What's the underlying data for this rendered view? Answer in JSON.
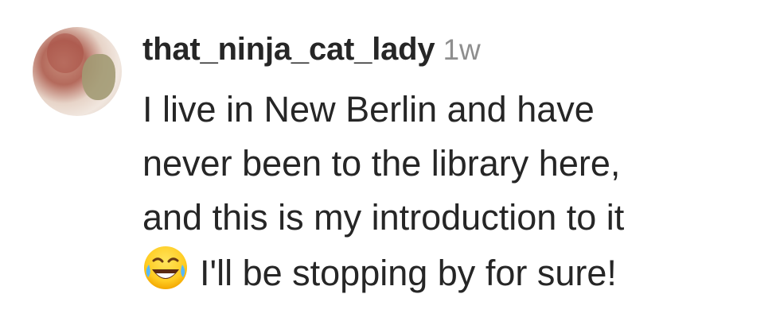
{
  "comment": {
    "username": "that_ninja_cat_lady",
    "timestamp": "1w",
    "avatar_icon": "profile-photo",
    "lines": [
      "I live in New Berlin and have",
      "never been to the library here,",
      "and this is my introduction to it",
      "I'll be stopping by for sure!"
    ],
    "emoji_icon": "laughing-crying-face"
  }
}
